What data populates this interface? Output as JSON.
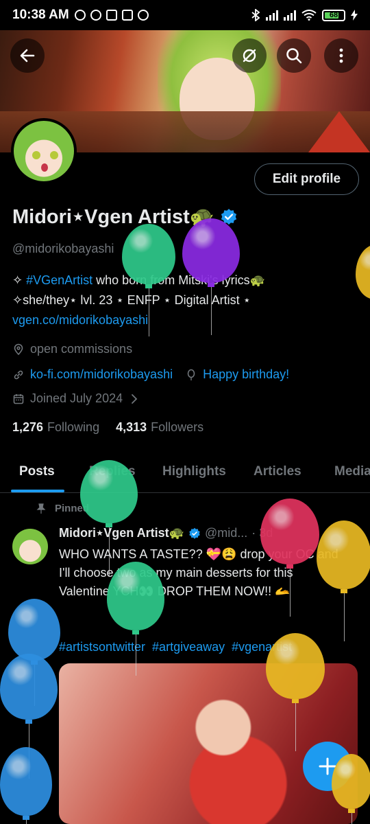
{
  "status_bar": {
    "time": "10:38 AM",
    "battery": "68",
    "icons": [
      "mute-icon",
      "alarm-icon",
      "discord-icon",
      "discord-icon",
      "whatsapp-icon",
      "bluetooth-icon",
      "signal-icon",
      "signal-icon",
      "wifi-icon",
      "battery-icon",
      "charging-icon"
    ]
  },
  "header": {
    "back_icon": "arrow-left-icon",
    "actions": [
      "translate-icon",
      "search-icon",
      "more-vertical-icon"
    ]
  },
  "profile": {
    "edit_button": "Edit profile",
    "display_name": "Midori⋆Vgen Artist🐢",
    "handle": "@midorikobayashi",
    "bio_prefix": "✧ ",
    "bio_hashtag": "#VGenArtist",
    "bio_line1_rest": " who born from Mitski's lyrics🐢",
    "bio_line2": "✧she/they⋆ lvl. 23 ⋆ ENFP ⋆ Digital Artist ⋆ ",
    "bio_link": "vgen.co/midorikobayashi",
    "location": "open commissions",
    "website": "ko-fi.com/midorikobayashi",
    "birthday": "Happy birthday!",
    "joined": "Joined July 2024",
    "following_count": "1,276",
    "following_label": "Following",
    "followers_count": "4,313",
    "followers_label": "Followers"
  },
  "tabs": [
    "Posts",
    "Replies",
    "Highlights",
    "Articles",
    "Media"
  ],
  "pinned_post": {
    "pinned_label": "Pinned",
    "author": "Midori⋆Vgen Artist🐢",
    "handle": "@mid...",
    "time": "· 3d",
    "text": "WHO WANTS A TASTE?? 💝😩 drop your OC and I'll choose two as my main desserts for this Valentine YCH👀 DROP THEM NOW!! 🫴",
    "hashtags": [
      "#artistsontwitter",
      "#artgiveaway",
      "#vgenartist"
    ]
  },
  "colors": {
    "accent": "#1d9bf0",
    "secondary_text": "#71767b",
    "primary_text": "#e7e9ea",
    "background": "#000000"
  },
  "balloon_colors": [
    "#2fc98a",
    "#8a2be2",
    "#e8b923",
    "#2fc98a",
    "#e0335e",
    "#e8b923",
    "#2fc98a",
    "#2e8fe0",
    "#e8b923",
    "#2e8fe0",
    "#2e8fe0",
    "#e8b923"
  ]
}
